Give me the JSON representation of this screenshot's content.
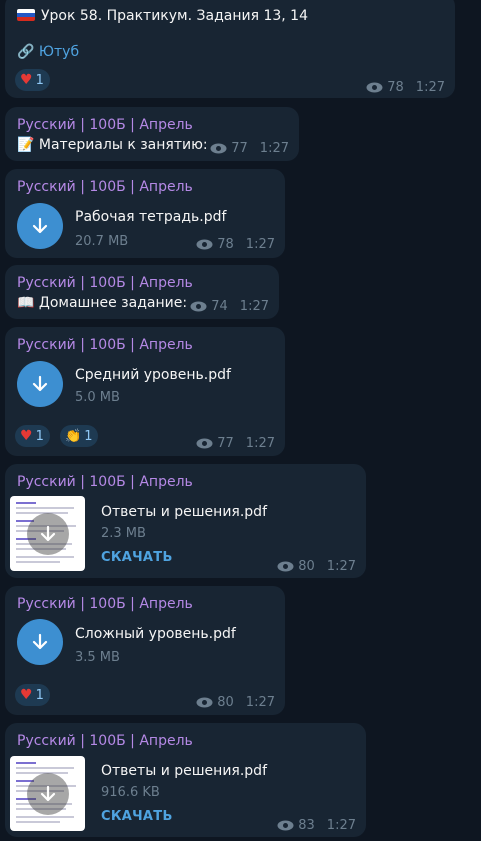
{
  "colors": {
    "background": "#0e1621",
    "bubble": "#182533",
    "sender": "#b589e6",
    "accent": "#4fa3e0",
    "download_button": "#3d8fd1",
    "heart": "#e53935"
  },
  "messages": [
    {
      "type": "text",
      "flag_icon": "russia-flag-icon",
      "text": "Урок 58. Практикум. Задания 13, 14",
      "link_icon": "link-icon",
      "link_text": "Ютуб",
      "reactions": [
        {
          "icon": "heart-icon",
          "count": "1"
        }
      ],
      "views": "78",
      "time": "1:27"
    },
    {
      "type": "text",
      "sender": "Русский | 100Б | Апрель",
      "emoji": "📝",
      "text": "Материалы к занятию:",
      "views": "77",
      "time": "1:27"
    },
    {
      "type": "file",
      "sender": "Русский | 100Б | Апрель",
      "file_name": "Рабочая тетрадь.pdf",
      "file_size": "20.7 MB",
      "views": "78",
      "time": "1:27"
    },
    {
      "type": "text",
      "sender": "Русский | 100Б | Апрель",
      "emoji": "📖",
      "text": "Домашнее задание:",
      "views": "74",
      "time": "1:27"
    },
    {
      "type": "file",
      "sender": "Русский | 100Б | Апрель",
      "file_name": "Средний уровень.pdf",
      "file_size": "5.0 MB",
      "reactions": [
        {
          "icon": "heart-icon",
          "count": "1"
        },
        {
          "icon": "clap-icon",
          "count": "1"
        }
      ],
      "views": "77",
      "time": "1:27"
    },
    {
      "type": "file-thumb",
      "sender": "Русский | 100Б | Апрель",
      "file_name": "Ответы и решения.pdf",
      "file_size": "2.3 MB",
      "download_label": "СКАЧАТЬ",
      "views": "80",
      "time": "1:27"
    },
    {
      "type": "file",
      "sender": "Русский | 100Б | Апрель",
      "file_name": "Сложный уровень.pdf",
      "file_size": "3.5 MB",
      "reactions": [
        {
          "icon": "heart-icon",
          "count": "1"
        }
      ],
      "views": "80",
      "time": "1:27"
    },
    {
      "type": "file-thumb",
      "sender": "Русский | 100Б | Апрель",
      "file_name": "Ответы и решения.pdf",
      "file_size": "916.6 KB",
      "download_label": "СКАЧАТЬ",
      "views": "83",
      "time": "1:27"
    }
  ]
}
